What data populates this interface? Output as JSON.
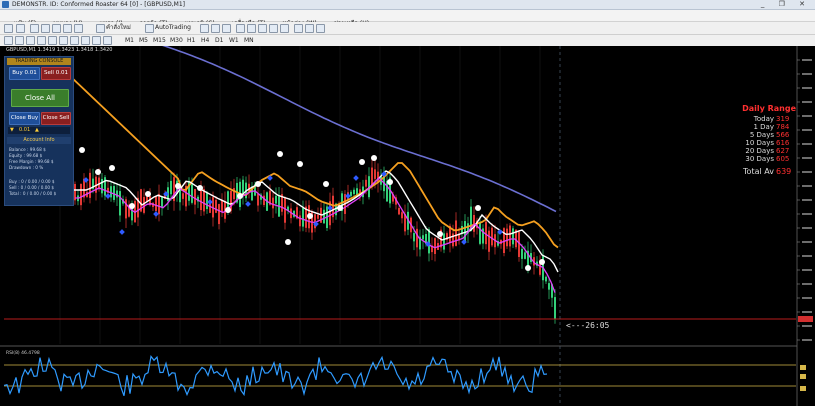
{
  "window": {
    "title": "DEMONSTR. ID: Conformed Roaster 64 [0] - [GBPUSD,M1]",
    "controls": "_ ❐ ✕"
  },
  "menu": [
    "แฟ้ม (F)",
    "มุมมอง (V)",
    "แทรก (I)",
    "การค้า (T)",
    "แผนภูมิ (C)",
    "เครื่องมือ (T)",
    "หน้าต่าง (W)",
    "ช่วยเหลือ (H)"
  ],
  "toolbar": {
    "new_order_label": "คำสั่งใหม่",
    "autotrading_label": "AutoTrading",
    "timeframes": [
      "M1",
      "M5",
      "M15",
      "M30",
      "H1",
      "H4",
      "D1",
      "W1",
      "MN"
    ]
  },
  "chart": {
    "symbol_header": "GBPUSD,M1  1.3419 1.3423 1.3418 1.3420",
    "indicator_label": "RSI(8) 46.4798",
    "countdown": "<---26:05",
    "colors": {
      "candle_up": "#33d17a",
      "candle_down": "#e53935",
      "ma_slow": "#6b6fd1",
      "ma_mid": "#f5a020",
      "ma_fast": "#ffffff",
      "ma_signal": "#e040fb",
      "oscillator": "#2f9bff"
    }
  },
  "trade_panel": {
    "title": "TRADING CONSOLE",
    "buy_label": "Buy 0.01",
    "sell_label": "Sell 0.01",
    "close_all_label": "Close All",
    "close_buy_label": "Close Buy",
    "close_sell_label": "Close Sell",
    "lot_value": "0.01",
    "account_title": "Account Info",
    "account_rows": [
      "Balance : 99.68 $",
      "Equity : 99.68 $",
      "Free Margin : 99.68 $",
      "Drawdown : 0 %",
      "Buy : 0 / 0.00 / 0.00 $",
      "Sell : 0 / 0.00 / 0.00 $",
      "Total : 0 / 0.00 / 0.00 $"
    ]
  },
  "daily_range": {
    "title": "Daily Range",
    "rows": [
      {
        "label": "Today",
        "value": "319"
      },
      {
        "label": "1 Day",
        "value": "784"
      },
      {
        "label": "5 Days",
        "value": "566"
      },
      {
        "label": "10 Days",
        "value": "616"
      },
      {
        "label": "20 Days",
        "value": "627"
      },
      {
        "label": "30 Days",
        "value": "605"
      }
    ],
    "total_label": "Total Av",
    "total_value": "639"
  }
}
